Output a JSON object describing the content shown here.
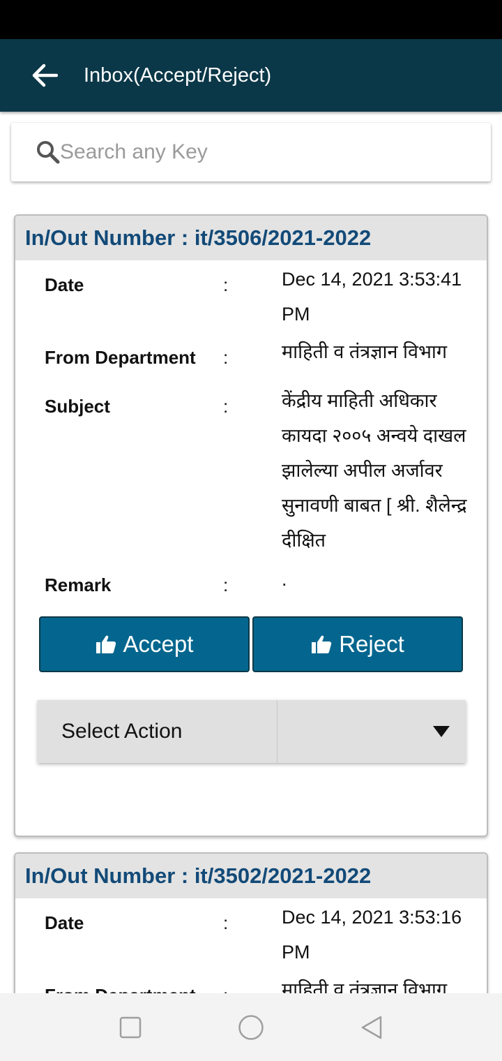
{
  "app_bar": {
    "title": "Inbox(Accept/Reject)"
  },
  "search": {
    "placeholder": "Search any Key"
  },
  "cards": [
    {
      "title": "In/Out Number : it/3506/2021-2022",
      "date_label": "Date",
      "date_value": "Dec 14, 2021 3:53:41 PM",
      "from_label": "From Department",
      "from_value": "माहिती व तंत्रज्ञान विभाग",
      "subject_label": "Subject",
      "subject_value": "केंद्रीय माहिती अधिकार कायदा २००५ अन्वये दाखल झालेल्या अपील अर्जावर सुनावणी बाबत [ श्री. शैलेन्द्र दीक्षित",
      "remark_label": "Remark",
      "remark_value": ".",
      "colon": ":",
      "accept_label": "Accept",
      "reject_label": "Reject",
      "select_label": "Select Action"
    },
    {
      "title": "In/Out Number : it/3502/2021-2022",
      "date_label": "Date",
      "date_value": "Dec 14, 2021 3:53:16 PM",
      "from_label": "From Department",
      "from_value": "माहिती व तंत्रज्ञान विभाग",
      "colon": ":"
    }
  ],
  "icons": {
    "back": "arrow-left-icon",
    "search": "search-icon",
    "accept": "thumbs-up-icon",
    "reject": "thumbs-up-icon",
    "dropdown": "caret-down-icon",
    "nav_recent": "square-icon",
    "nav_home": "circle-icon",
    "nav_back": "triangle-back-icon"
  },
  "colors": {
    "app_bar": "#0b3848",
    "card_title": "#124a78",
    "button": "#04668e",
    "card_header": "#e3e3e3"
  }
}
